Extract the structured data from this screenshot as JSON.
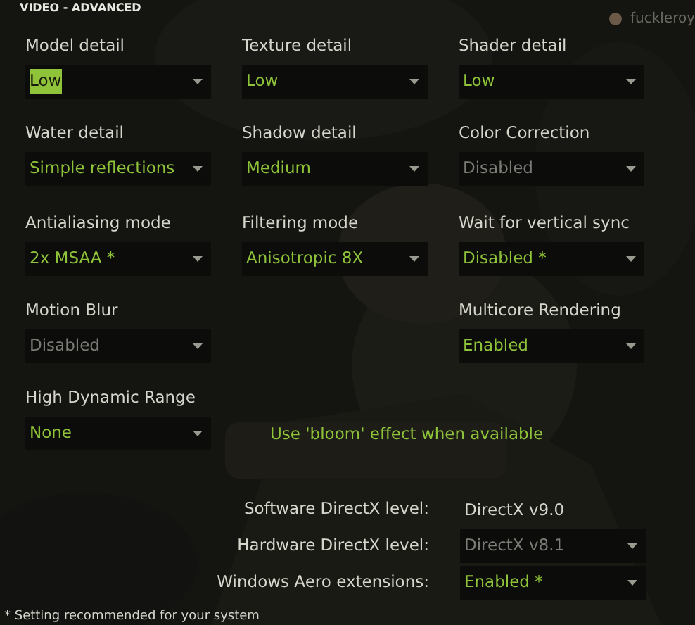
{
  "window": {
    "title": "VIDEO - ADVANCED"
  },
  "user": {
    "name": "fuckleroy"
  },
  "settings": [
    [
      {
        "kind": "dropdown",
        "label": "Model detail",
        "value": "Low",
        "disabled": false,
        "highlighted": true
      },
      {
        "kind": "dropdown",
        "label": "Texture detail",
        "value": "Low",
        "disabled": false,
        "highlighted": false
      },
      {
        "kind": "dropdown",
        "label": "Shader detail",
        "value": "Low",
        "disabled": false,
        "highlighted": false
      }
    ],
    [
      {
        "kind": "dropdown",
        "label": "Water detail",
        "value": "Simple reflections",
        "disabled": false,
        "highlighted": false
      },
      {
        "kind": "dropdown",
        "label": "Shadow detail",
        "value": "Medium",
        "disabled": false,
        "highlighted": false
      },
      {
        "kind": "dropdown",
        "label": "Color Correction",
        "value": "Disabled",
        "disabled": true,
        "highlighted": false
      }
    ],
    [
      {
        "kind": "dropdown",
        "label": "Antialiasing mode",
        "value": "2x MSAA *",
        "disabled": false,
        "highlighted": false
      },
      {
        "kind": "dropdown",
        "label": "Filtering mode",
        "value": "Anisotropic 8X",
        "disabled": false,
        "highlighted": false
      },
      {
        "kind": "dropdown",
        "label": "Wait for vertical sync",
        "value": "Disabled *",
        "disabled": false,
        "highlighted": false
      }
    ],
    [
      {
        "kind": "dropdown",
        "label": "Motion Blur",
        "value": "Disabled",
        "disabled": true,
        "highlighted": false
      },
      {
        "kind": "empty"
      },
      {
        "kind": "dropdown",
        "label": "Multicore Rendering",
        "value": "Enabled",
        "disabled": false,
        "highlighted": false
      }
    ],
    [
      {
        "kind": "dropdown",
        "label": "High Dynamic Range",
        "value": "None",
        "disabled": false,
        "highlighted": false
      },
      {
        "kind": "option",
        "label": "Use 'bloom' effect when available"
      }
    ]
  ],
  "directx": [
    {
      "kind": "text",
      "label": "Software DirectX level:",
      "value": "DirectX v9.0",
      "disabled": false
    },
    {
      "kind": "dropdown",
      "label": "Hardware DirectX level:",
      "value": "DirectX v8.1",
      "disabled": true
    },
    {
      "kind": "dropdown",
      "label": "Windows Aero extensions:",
      "value": "Enabled *",
      "disabled": false
    }
  ],
  "footnote": "* Setting recommended for your system"
}
